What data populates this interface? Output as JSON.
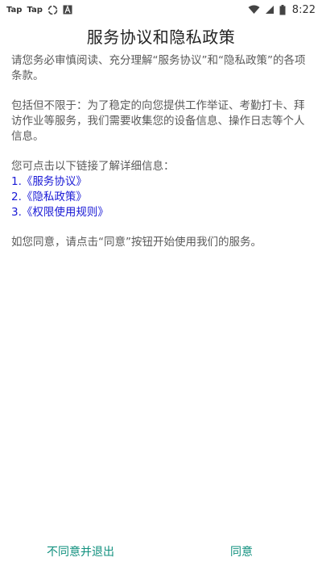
{
  "status_bar": {
    "app_badges": [
      "Tap",
      "Tap"
    ],
    "time": "8:22"
  },
  "dialog": {
    "title": "服务协议和隐私政策",
    "intro": "请您务必审慎阅读、充分理解“服务协议”和“隐私政策”的各项条款。",
    "collect": "包括但不限于：为了稳定的向您提供工作举证、考勤打卡、拜访作业等服务，我们需要收集您的设备信息、操作日志等个人信息。",
    "links_header": "您可点击以下链接了解详细信息：",
    "links": [
      {
        "label": "1.《服务协议》"
      },
      {
        "label": "2.《隐私政策》"
      },
      {
        "label": "3.《权限使用规则》"
      }
    ],
    "consent_prompt": "如您同意，请点击“同意”按钮开始使用我们的服务。"
  },
  "footer": {
    "decline_label": "不同意并退出",
    "agree_label": "同意"
  },
  "colors": {
    "link": "#1a1ad6",
    "accent": "#12917f",
    "body_text": "#5a5a5a"
  }
}
